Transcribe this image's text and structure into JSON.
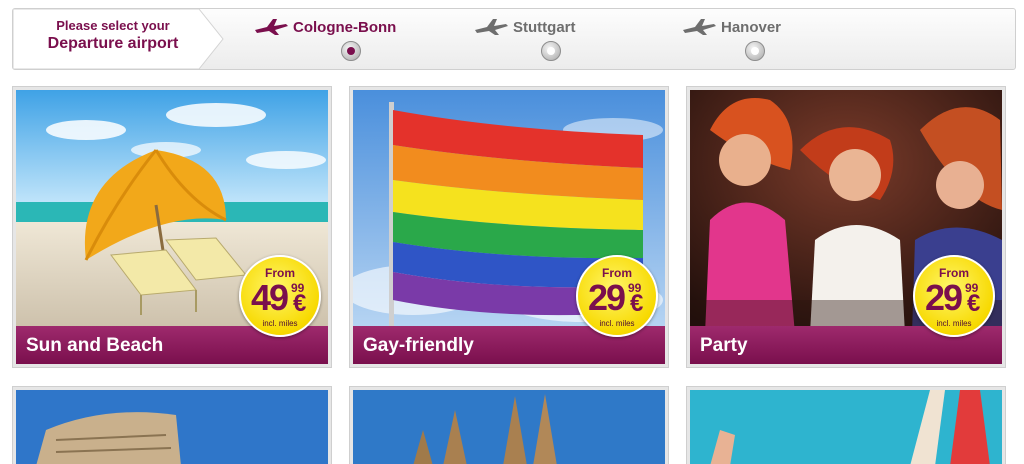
{
  "header": {
    "select_small": "Please select your",
    "select_big": "Departure airport",
    "airports": [
      {
        "name": "Cologne-Bonn",
        "selected": true
      },
      {
        "name": "Stuttgart",
        "selected": false
      },
      {
        "name": "Hanover",
        "selected": false
      }
    ]
  },
  "colors": {
    "brand": "#7a0f4d",
    "badge": "#f7d900"
  },
  "tiles": [
    {
      "label": "Sun and Beach",
      "price_label": "From",
      "price": "49",
      "cents": "99",
      "currency": "€",
      "note": "incl. miles",
      "icon": "beach-image"
    },
    {
      "label": "Gay-friendly",
      "price_label": "From",
      "price": "29",
      "cents": "99",
      "currency": "€",
      "note": "incl. miles",
      "icon": "rainbow-flag-image"
    },
    {
      "label": "Party",
      "price_label": "From",
      "price": "29",
      "cents": "99",
      "currency": "€",
      "note": "incl. miles",
      "icon": "party-image"
    }
  ]
}
